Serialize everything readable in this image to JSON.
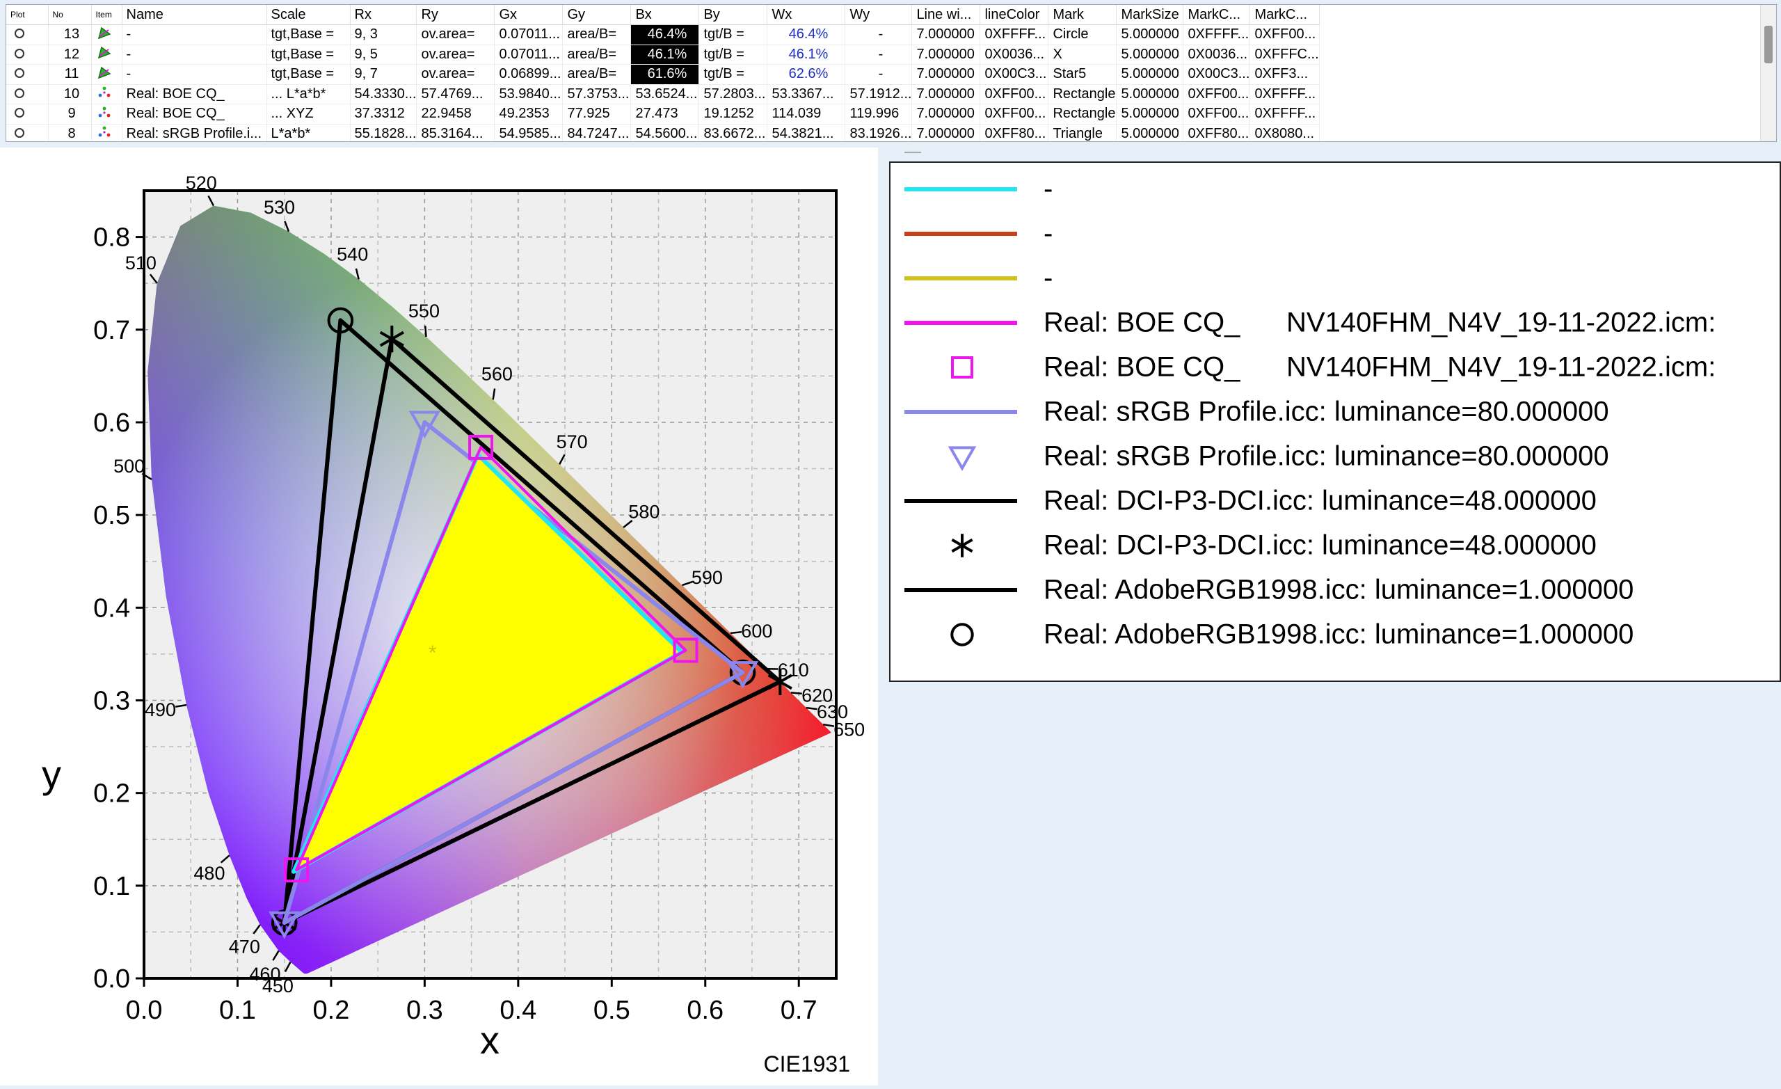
{
  "table": {
    "columns": [
      "Plot",
      "No",
      "Item",
      "Name",
      "Scale",
      "Rx",
      "Ry",
      "Gx",
      "Gy",
      "Bx",
      "By",
      "Wx",
      "Wy",
      "Line wi...",
      "lineColor",
      "Mark",
      "MarkSize",
      "MarkC...",
      "MarkC..."
    ],
    "rows": [
      {
        "no": "13",
        "icon": "green",
        "name": "-",
        "scale": "tgt,Base =",
        "rx": "9, 3",
        "ry": "ov.area=",
        "gx": "0.07011...",
        "gy": "area/B=",
        "bx": "46.4%",
        "by": "tgt/B =",
        "wx": "46.4%",
        "wy": "-",
        "linew": "7.000000",
        "linecolor": "0XFFFF...",
        "mark": "Circle",
        "marksize": "5.000000",
        "markc1": "0XFFFF...",
        "markc2": "0XFF00..."
      },
      {
        "no": "12",
        "icon": "green",
        "name": "-",
        "scale": "tgt,Base =",
        "rx": "9, 5",
        "ry": "ov.area=",
        "gx": "0.07011...",
        "gy": "area/B=",
        "bx": "46.1%",
        "by": "tgt/B =",
        "wx": "46.1%",
        "wy": "-",
        "linew": "7.000000",
        "linecolor": "0X0036...",
        "mark": "X",
        "marksize": "5.000000",
        "markc1": "0X0036...",
        "markc2": "0XFFFC..."
      },
      {
        "no": "11",
        "icon": "green",
        "name": "-",
        "scale": "tgt,Base =",
        "rx": "9, 7",
        "ry": "ov.area=",
        "gx": "0.06899...",
        "gy": "area/B=",
        "bx": "61.6%",
        "by": "tgt/B =",
        "wx": "62.6%",
        "wy": "-",
        "linew": "7.000000",
        "linecolor": "0X00C3...",
        "mark": "Star5",
        "marksize": "5.000000",
        "markc1": "0X00C3...",
        "markc2": "0XFF3..."
      },
      {
        "no": "10",
        "icon": "dots",
        "name": "Real: BOE CQ_",
        "scale": "... L*a*b*",
        "rx": "54.3330...",
        "ry": "57.4769...",
        "gx": "53.9840...",
        "gy": "57.3753...",
        "bx": "53.6524...",
        "by": "57.2803...",
        "wx": "53.3367...",
        "wy": "57.1912...",
        "linew": "7.000000",
        "linecolor": "0XFF00...",
        "mark": "Rectangle",
        "marksize": "5.000000",
        "markc1": "0XFF00...",
        "markc2": "0XFFFF..."
      },
      {
        "no": "9",
        "icon": "dots",
        "name": "Real: BOE CQ_",
        "scale": "... XYZ",
        "rx": "37.3312",
        "ry": "22.9458",
        "gx": "49.2353",
        "gy": "77.925",
        "bx": "27.473",
        "by": "19.1252",
        "wx": "114.039",
        "wy": "119.996",
        "linew": "7.000000",
        "linecolor": "0XFF00...",
        "mark": "Rectangle",
        "marksize": "5.000000",
        "markc1": "0XFF00...",
        "markc2": "0XFFFF..."
      },
      {
        "no": "8",
        "icon": "dots",
        "name": "Real: sRGB Profile.i...",
        "scale": "L*a*b*",
        "rx": "55.1828...",
        "ry": "85.3164...",
        "gx": "54.9585...",
        "gy": "84.7247...",
        "bx": "54.5600...",
        "by": "83.6672...",
        "wx": "54.3821...",
        "wy": "83.1926...",
        "linew": "7.000000",
        "linecolor": "0XFF80...",
        "mark": "Triangle",
        "marksize": "5.000000",
        "markc1": "0XFF80...",
        "markc2": "0X8080..."
      }
    ]
  },
  "chart_data": {
    "type": "scatter",
    "subtype": "CIE1931 chromaticity diagram",
    "xlabel": "x",
    "ylabel": "y",
    "corner_label": "CIE1931",
    "xlim": [
      0.0,
      0.74
    ],
    "ylim": [
      0.0,
      0.85
    ],
    "xticks": [
      "0.0",
      "0.1",
      "0.2",
      "0.3",
      "0.4",
      "0.5",
      "0.6",
      "0.7"
    ],
    "yticks": [
      "0.0",
      "0.1",
      "0.2",
      "0.3",
      "0.4",
      "0.5",
      "0.6",
      "0.7",
      "0.8"
    ],
    "grid": true,
    "wavelength_labels": [
      {
        "label": "450",
        "x": 0.1566,
        "y": 0.0177
      },
      {
        "label": "460",
        "x": 0.144,
        "y": 0.0297
      },
      {
        "label": "470",
        "x": 0.1241,
        "y": 0.0578
      },
      {
        "label": "480",
        "x": 0.0913,
        "y": 0.1327
      },
      {
        "label": "490",
        "x": 0.0454,
        "y": 0.295
      },
      {
        "label": "500",
        "x": 0.0082,
        "y": 0.5384
      },
      {
        "label": "510",
        "x": 0.0139,
        "y": 0.7502
      },
      {
        "label": "520",
        "x": 0.0743,
        "y": 0.8338
      },
      {
        "label": "530",
        "x": 0.1547,
        "y": 0.8059
      },
      {
        "label": "540",
        "x": 0.2296,
        "y": 0.7543
      },
      {
        "label": "550",
        "x": 0.3016,
        "y": 0.6923
      },
      {
        "label": "560",
        "x": 0.3731,
        "y": 0.6245
      },
      {
        "label": "570",
        "x": 0.4441,
        "y": 0.5547
      },
      {
        "label": "580",
        "x": 0.5125,
        "y": 0.4866
      },
      {
        "label": "590",
        "x": 0.5752,
        "y": 0.4242
      },
      {
        "label": "600",
        "x": 0.627,
        "y": 0.3725
      },
      {
        "label": "610",
        "x": 0.6658,
        "y": 0.334
      },
      {
        "label": "620",
        "x": 0.6915,
        "y": 0.3083
      },
      {
        "label": "630",
        "x": 0.7079,
        "y": 0.292
      },
      {
        "label": "650",
        "x": 0.726,
        "y": 0.274
      }
    ],
    "series": [
      {
        "name": "-",
        "color": "#22e6f2",
        "marker": "none",
        "points": [
          [
            0.575,
            0.352
          ],
          [
            0.357,
            0.565
          ],
          [
            0.16,
            0.115
          ]
        ],
        "fill": "#ffff00"
      },
      {
        "name": "-",
        "color": "#c8401a",
        "marker": "none",
        "points": []
      },
      {
        "name": "-",
        "color": "#cfc21a",
        "marker": "none",
        "points": []
      },
      {
        "name": "Real: BOE CQ_      NV140FHM_N4V_19-11-2022.icm:",
        "color": "#ee16ee",
        "marker": "square",
        "points": [
          [
            0.579,
            0.354
          ],
          [
            0.36,
            0.573
          ],
          [
            0.163,
            0.117
          ]
        ]
      },
      {
        "name": "Real: sRGB Profile.icc: luminance=80.000000",
        "color": "#8a86ec",
        "marker": "triangle",
        "points": [
          [
            0.64,
            0.33
          ],
          [
            0.3,
            0.6
          ],
          [
            0.15,
            0.06
          ]
        ]
      },
      {
        "name": "Real: DCI-P3-DCI.icc: luminance=48.000000",
        "color": "#000000",
        "marker": "star",
        "points": [
          [
            0.68,
            0.32
          ],
          [
            0.265,
            0.69
          ],
          [
            0.15,
            0.06
          ]
        ]
      },
      {
        "name": "Real: AdobeRGB1998.icc: luminance=1.000000",
        "color": "#000000",
        "marker": "circle",
        "points": [
          [
            0.64,
            0.33
          ],
          [
            0.21,
            0.71
          ],
          [
            0.15,
            0.06
          ]
        ]
      }
    ]
  },
  "legend": {
    "items": [
      {
        "sym": "line",
        "color": "#22e6f2",
        "label": "-"
      },
      {
        "sym": "line",
        "color": "#c8401a",
        "label": "-"
      },
      {
        "sym": "line",
        "color": "#cfc21a",
        "label": "-"
      },
      {
        "sym": "line",
        "color": "#ee16ee",
        "label": "Real: BOE CQ_      NV140FHM_N4V_19-11-2022.icm:"
      },
      {
        "sym": "square",
        "color": "#ee16ee",
        "label": "Real: BOE CQ_      NV140FHM_N4V_19-11-2022.icm:"
      },
      {
        "sym": "line",
        "color": "#8a86ec",
        "label": "Real: sRGB Profile.icc: luminance=80.000000"
      },
      {
        "sym": "triangle",
        "color": "#8a86ec",
        "label": "Real: sRGB Profile.icc: luminance=80.000000"
      },
      {
        "sym": "line",
        "color": "#000000",
        "label": "Real: DCI-P3-DCI.icc: luminance=48.000000"
      },
      {
        "sym": "star",
        "color": "#000000",
        "label": "Real: DCI-P3-DCI.icc: luminance=48.000000"
      },
      {
        "sym": "line",
        "color": "#000000",
        "label": "Real: AdobeRGB1998.icc: luminance=1.000000"
      },
      {
        "sym": "circle",
        "color": "#000000",
        "label": "Real: AdobeRGB1998.icc: luminance=1.000000"
      }
    ]
  }
}
